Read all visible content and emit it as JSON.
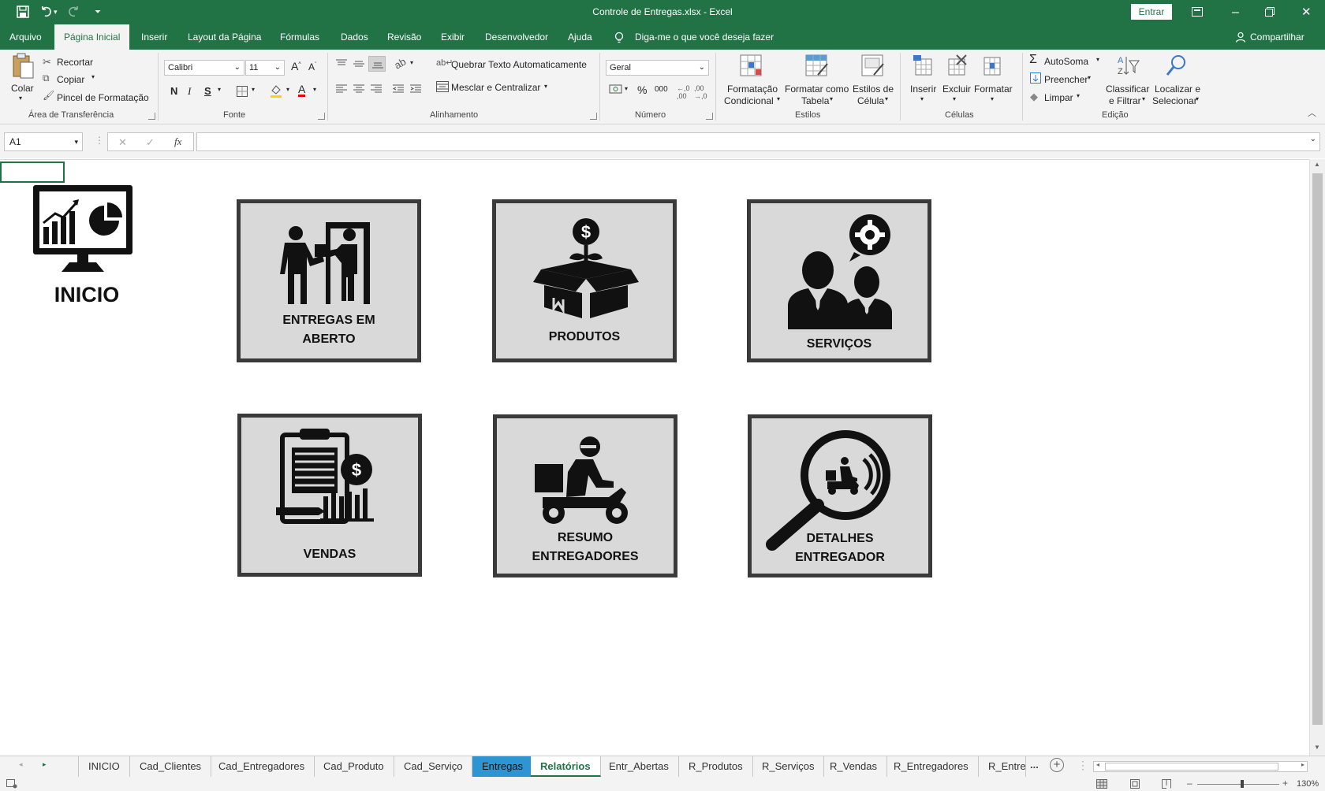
{
  "window": {
    "title": "Controle de Entregas.xlsx  -  Excel",
    "signin_label": "Entrar",
    "accent": "#217346"
  },
  "menu": {
    "tabs": [
      "Arquivo",
      "Página Inicial",
      "Inserir",
      "Layout da Página",
      "Fórmulas",
      "Dados",
      "Revisão",
      "Exibir",
      "Desenvolvedor",
      "Ajuda"
    ],
    "active_tab": "Página Inicial",
    "tell_me": "Diga-me o que você deseja fazer",
    "share": "Compartilhar"
  },
  "ribbon": {
    "clipboard": {
      "paste": "Colar",
      "cut": "Recortar",
      "copy": "Copiar",
      "format_painter": "Pincel de Formatação",
      "label": "Área de Transferência"
    },
    "font": {
      "name": "Calibri",
      "size": "11",
      "bold": "N",
      "italic": "I",
      "underline": "S",
      "label": "Fonte"
    },
    "alignment": {
      "wrap": "Quebrar Texto Automaticamente",
      "merge": "Mesclar e Centralizar",
      "label": "Alinhamento"
    },
    "number": {
      "format": "Geral",
      "percent": "%",
      "thousands": "000",
      "label": "Número"
    },
    "styles": {
      "conditional_1": "Formatação",
      "conditional_2": "Condicional",
      "table_1": "Formatar como",
      "table_2": "Tabela",
      "cell_1": "Estilos de",
      "cell_2": "Célula",
      "label": "Estilos"
    },
    "cells": {
      "insert": "Inserir",
      "delete": "Excluir",
      "format": "Formatar",
      "label": "Células"
    },
    "editing": {
      "autosum": "AutoSoma",
      "fill": "Preencher",
      "clear": "Limpar",
      "sort_1": "Classificar",
      "sort_2": "e Filtrar",
      "find_1": "Localizar e",
      "find_2": "Selecionar",
      "label": "Edição"
    }
  },
  "formula_bar": {
    "cell_ref": "A1",
    "fx": "fx",
    "value": ""
  },
  "dashboard": {
    "home_label": "INICIO",
    "tiles": [
      {
        "line1": "ENTREGAS EM",
        "line2": "ABERTO",
        "icon": "delivery-handover-icon"
      },
      {
        "line1": "PRODUTOS",
        "line2": "",
        "icon": "product-box-icon"
      },
      {
        "line1": "SERVIÇOS",
        "line2": "",
        "icon": "service-people-icon"
      },
      {
        "line1": "VENDAS",
        "line2": "",
        "icon": "sales-clipboard-icon"
      },
      {
        "line1": "RESUMO",
        "line2": "ENTREGADORES",
        "icon": "delivery-scooter-icon"
      },
      {
        "line1": "DETALHES",
        "line2": "ENTREGADOR",
        "icon": "magnifier-courier-icon"
      }
    ]
  },
  "sheet_tabs": [
    "INICIO",
    "Cad_Clientes",
    "Cad_Entregadores",
    "Cad_Produto",
    "Cad_Serviço",
    "Entregas",
    "Relatórios",
    "Entr_Abertas",
    "R_Produtos",
    "R_Serviços",
    "R_Vendas",
    "R_Entregadores",
    "R_Entreç"
  ],
  "active_sheet": "Relatórios",
  "colored_sheet": "Entregas",
  "ellipsis": "...",
  "status": {
    "zoom": "130%"
  }
}
